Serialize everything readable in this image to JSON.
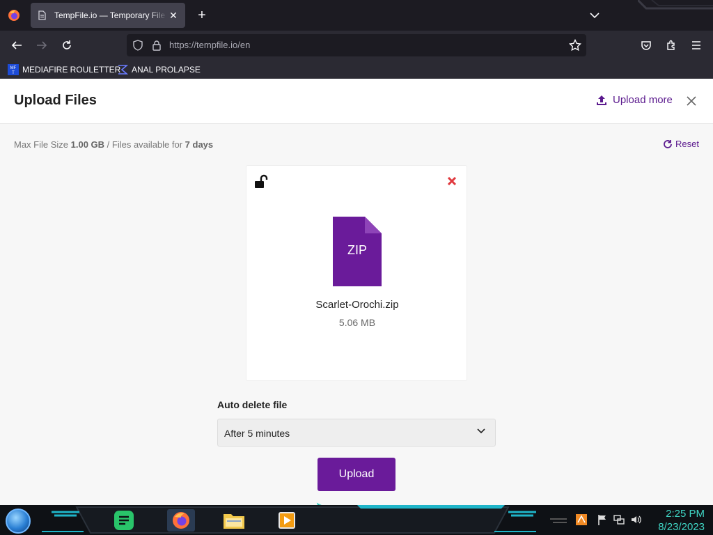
{
  "browser": {
    "tab_title": "TempFile.io — Temporary File Upload",
    "url_host": "https://tempfile.io",
    "url_path": "/en",
    "bookmarks": [
      {
        "label": "MEDIAFIRE ROULETTER"
      },
      {
        "label": "ANAL PROLAPSE"
      }
    ]
  },
  "page": {
    "title": "Upload Files",
    "upload_more": "Upload more",
    "limits": {
      "max_prefix": "Max File Size ",
      "max_value": "1.00 GB",
      "avail_prefix": " / Files available for ",
      "avail_value": "7 days"
    },
    "reset": "Reset",
    "file": {
      "type_label": "ZIP",
      "name": "Scarlet-Orochi.zip",
      "size": "5.06 MB"
    },
    "auto_delete_label": "Auto delete file",
    "auto_delete_value": "After 5 minutes",
    "upload_button": "Upload"
  },
  "taskbar": {
    "time": "2:25 PM",
    "date": "8/23/2023"
  },
  "colors": {
    "brand_purple": "#6a1b9a",
    "link_purple": "#5b1a8e",
    "remove_red": "#e0393e",
    "clock_teal": "#3fd5c4"
  },
  "icons": [
    "firefox-icon",
    "tab-favicon",
    "close-icon",
    "plus-icon",
    "chevron-down-icon",
    "back-icon",
    "forward-icon",
    "reload-icon",
    "shield-icon",
    "lock-icon",
    "star-icon",
    "pocket-icon",
    "extensions-icon",
    "menu-icon",
    "upload-icon",
    "reset-icon",
    "unlock-icon",
    "remove-icon",
    "zip-file-icon",
    "cursor-icon"
  ]
}
